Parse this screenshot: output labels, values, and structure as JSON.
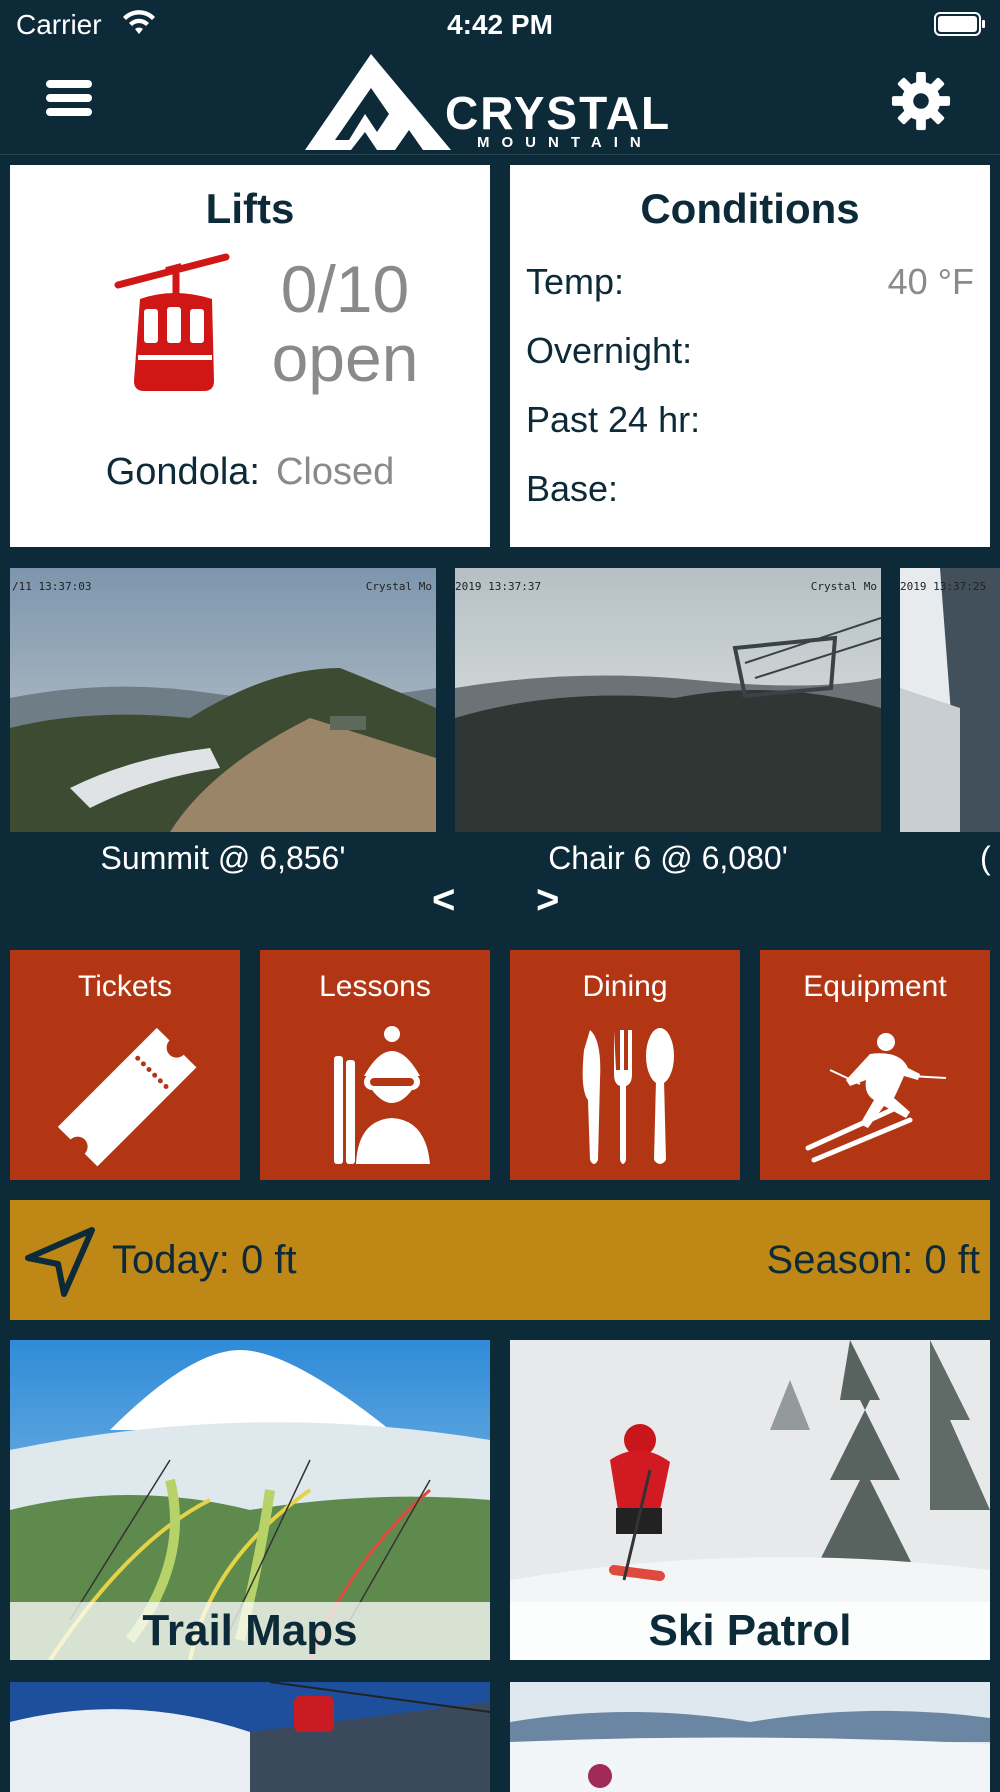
{
  "status_bar": {
    "carrier": "Carrier",
    "time": "4:42 PM"
  },
  "header": {
    "brand_name": "CRYSTAL",
    "brand_sub": "MOUNTAIN"
  },
  "lifts": {
    "title": "Lifts",
    "count": "0/10",
    "status_word": "open",
    "gondola_label": "Gondola:",
    "gondola_value": "Closed",
    "open_lifts": 0,
    "total_lifts": 10
  },
  "conditions": {
    "title": "Conditions",
    "rows": [
      {
        "label": "Temp:",
        "value": "40 °F"
      },
      {
        "label": "Overnight:",
        "value": ""
      },
      {
        "label": "Past 24 hr:",
        "value": ""
      },
      {
        "label": "Base:",
        "value": ""
      }
    ]
  },
  "webcams": [
    {
      "label": "Summit @ 6,856'",
      "stamp_left": "/11 13:37:03",
      "stamp_right": "Crystal Mo"
    },
    {
      "label": "Chair 6 @ 6,080'",
      "stamp_left": "2019 13:37:37",
      "stamp_right": "Crystal Mo"
    },
    {
      "label": "(",
      "stamp_left": "2019 13:37:25",
      "stamp_right": ""
    }
  ],
  "carousel": {
    "prev": "<",
    "next": ">"
  },
  "tiles": [
    {
      "label": "Tickets",
      "icon": "ticket-icon"
    },
    {
      "label": "Lessons",
      "icon": "ski-instructor-icon"
    },
    {
      "label": "Dining",
      "icon": "cutlery-icon"
    },
    {
      "label": "Equipment",
      "icon": "skier-icon"
    }
  ],
  "vertical": {
    "today": "Today: 0 ft",
    "season": "Season: 0 ft"
  },
  "features": [
    {
      "label": "Trail Maps"
    },
    {
      "label": "Ski Patrol"
    }
  ],
  "colors": {
    "background": "#0d2a38",
    "tile_red": "#b23614",
    "vertical_gold": "#bf8816",
    "gondola_red": "#d11616"
  }
}
